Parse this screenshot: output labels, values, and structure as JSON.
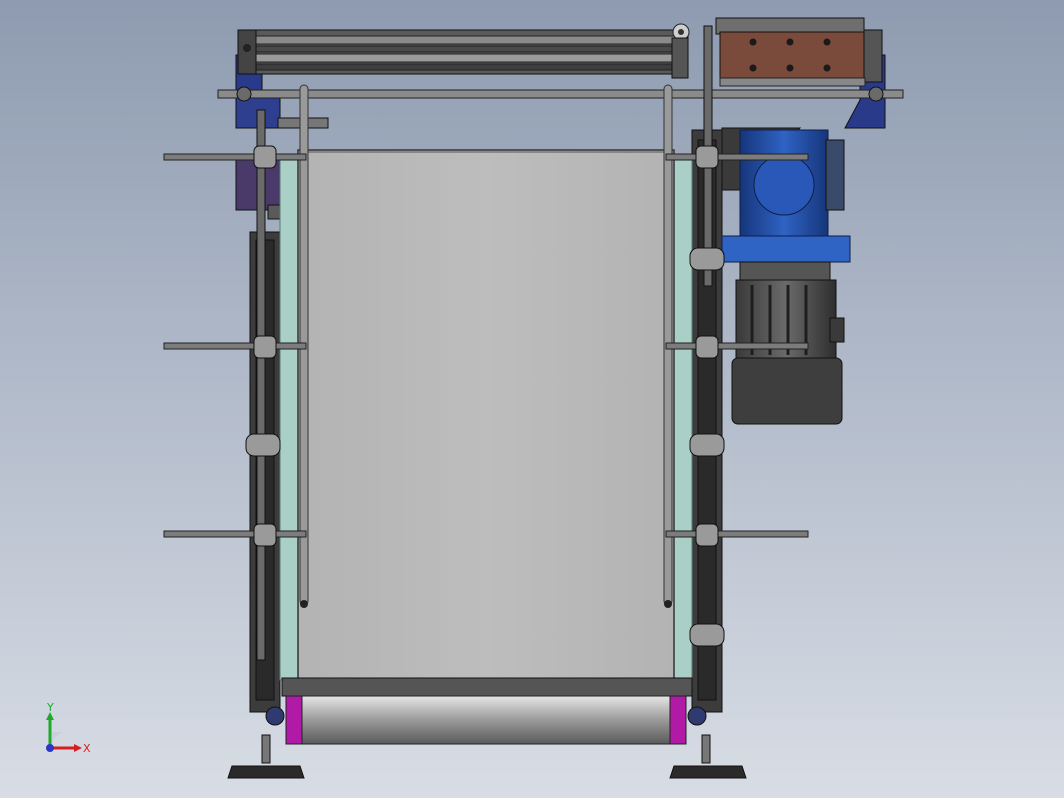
{
  "viewport": {
    "background_top": "#8e9bb0",
    "background_bottom": "#d8dde5"
  },
  "triad": {
    "x_label": "X",
    "y_label": "Y",
    "x_color": "#d62020",
    "y_color": "#1fa82a",
    "z_color": "#2a36c8"
  },
  "model": {
    "belt_color": "#b9b9b9",
    "frame_color": "#3c3c3c",
    "motor_color": "#1f4fa8",
    "gearbox_color": "#7a4a3a",
    "bracket_color": "#2a3a8a",
    "side_guard_color": "#a9cfc7",
    "roller_accent_color": "#b01aa6",
    "icons": [
      "coordinate-triad-icon"
    ]
  }
}
